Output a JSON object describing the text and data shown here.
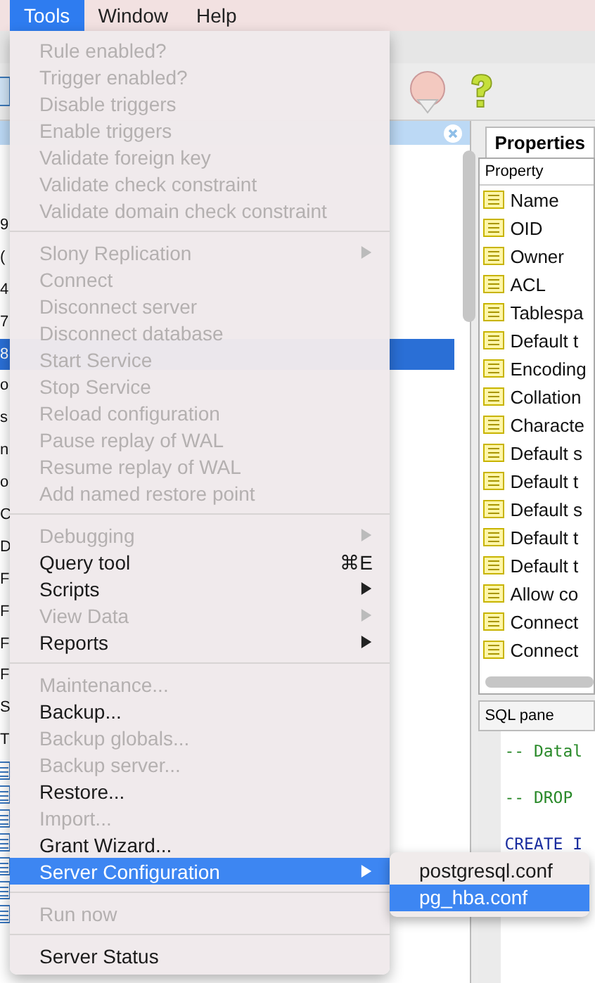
{
  "menubar": [
    {
      "label": "Tools",
      "selected": true
    },
    {
      "label": "Window",
      "selected": false
    },
    {
      "label": "Help",
      "selected": false
    }
  ],
  "tree": [
    {
      "text": "9",
      "selected": false
    },
    {
      "text": "(",
      "selected": false
    },
    {
      "text": "4",
      "selected": false
    },
    {
      "text": "7",
      "selected": false
    },
    {
      "text": "8",
      "selected": true
    },
    {
      "text": "o",
      "selected": false
    },
    {
      "text": "s",
      "selected": false
    },
    {
      "text": "n",
      "selected": false
    },
    {
      "text": "o",
      "selected": false
    },
    {
      "text": "C",
      "selected": false
    },
    {
      "text": "D",
      "selected": false
    },
    {
      "text": "F",
      "selected": false
    },
    {
      "text": "F",
      "selected": false
    },
    {
      "text": "F",
      "selected": false
    },
    {
      "text": "F",
      "selected": false
    },
    {
      "text": "S",
      "selected": false
    },
    {
      "text": "T",
      "selected": false
    }
  ],
  "properties": {
    "tab": "Properties",
    "column": "Property",
    "rows": [
      "Name",
      "OID",
      "Owner",
      "ACL",
      "Tablespa",
      "Default t",
      "Encoding",
      "Collation",
      "Characte",
      "Default s",
      "Default t",
      "Default s",
      "Default t",
      "Default t",
      "Allow co",
      "Connect",
      "Connect"
    ]
  },
  "sql_pane": {
    "title": "SQL pane",
    "lines": [
      {
        "text": "-- Datal",
        "kind": "comment"
      },
      {
        "text": "-- DROP",
        "kind": "comment"
      },
      {
        "text": "CREATE I",
        "kind": "keyword"
      }
    ]
  },
  "menu": [
    {
      "kind": "item",
      "label": "Rule enabled?",
      "disabled": true
    },
    {
      "kind": "item",
      "label": "Trigger enabled?",
      "disabled": true
    },
    {
      "kind": "item",
      "label": "Disable triggers",
      "disabled": true
    },
    {
      "kind": "item",
      "label": "Enable triggers",
      "disabled": true
    },
    {
      "kind": "item",
      "label": "Validate foreign key",
      "disabled": true
    },
    {
      "kind": "item",
      "label": "Validate check constraint",
      "disabled": true
    },
    {
      "kind": "item",
      "label": "Validate domain check constraint",
      "disabled": true
    },
    {
      "kind": "separator"
    },
    {
      "kind": "item",
      "label": "Slony Replication",
      "disabled": true,
      "submenu": true
    },
    {
      "kind": "item",
      "label": "Connect",
      "disabled": true
    },
    {
      "kind": "item",
      "label": "Disconnect server",
      "disabled": true
    },
    {
      "kind": "item",
      "label": "Disconnect database",
      "disabled": true
    },
    {
      "kind": "item",
      "label": "Start Service",
      "disabled": true
    },
    {
      "kind": "item",
      "label": "Stop Service",
      "disabled": true
    },
    {
      "kind": "item",
      "label": "Reload configuration",
      "disabled": true
    },
    {
      "kind": "item",
      "label": "Pause replay of WAL",
      "disabled": true
    },
    {
      "kind": "item",
      "label": "Resume replay of WAL",
      "disabled": true
    },
    {
      "kind": "item",
      "label": "Add named restore point",
      "disabled": true
    },
    {
      "kind": "separator"
    },
    {
      "kind": "item",
      "label": "Debugging",
      "disabled": true,
      "submenu": true
    },
    {
      "kind": "item",
      "label": "Query tool",
      "disabled": false,
      "shortcut": "⌘E"
    },
    {
      "kind": "item",
      "label": "Scripts",
      "disabled": false,
      "submenu": true
    },
    {
      "kind": "item",
      "label": "View Data",
      "disabled": true,
      "submenu": true
    },
    {
      "kind": "item",
      "label": "Reports",
      "disabled": false,
      "submenu": true
    },
    {
      "kind": "separator"
    },
    {
      "kind": "item",
      "label": "Maintenance...",
      "disabled": true
    },
    {
      "kind": "item",
      "label": "Backup...",
      "disabled": false
    },
    {
      "kind": "item",
      "label": "Backup globals...",
      "disabled": true
    },
    {
      "kind": "item",
      "label": "Backup server...",
      "disabled": true
    },
    {
      "kind": "item",
      "label": "Restore...",
      "disabled": false
    },
    {
      "kind": "item",
      "label": "Import...",
      "disabled": true
    },
    {
      "kind": "item",
      "label": "Grant Wizard...",
      "disabled": false
    },
    {
      "kind": "item",
      "label": "Server Configuration",
      "disabled": false,
      "submenu": true,
      "selected": true
    },
    {
      "kind": "separator"
    },
    {
      "kind": "item",
      "label": "Run now",
      "disabled": true
    },
    {
      "kind": "separator"
    },
    {
      "kind": "item",
      "label": "Server Status",
      "disabled": false
    }
  ],
  "submenu": [
    {
      "label": "postgresql.conf",
      "selected": false
    },
    {
      "label": "pg_hba.conf",
      "selected": true
    }
  ]
}
